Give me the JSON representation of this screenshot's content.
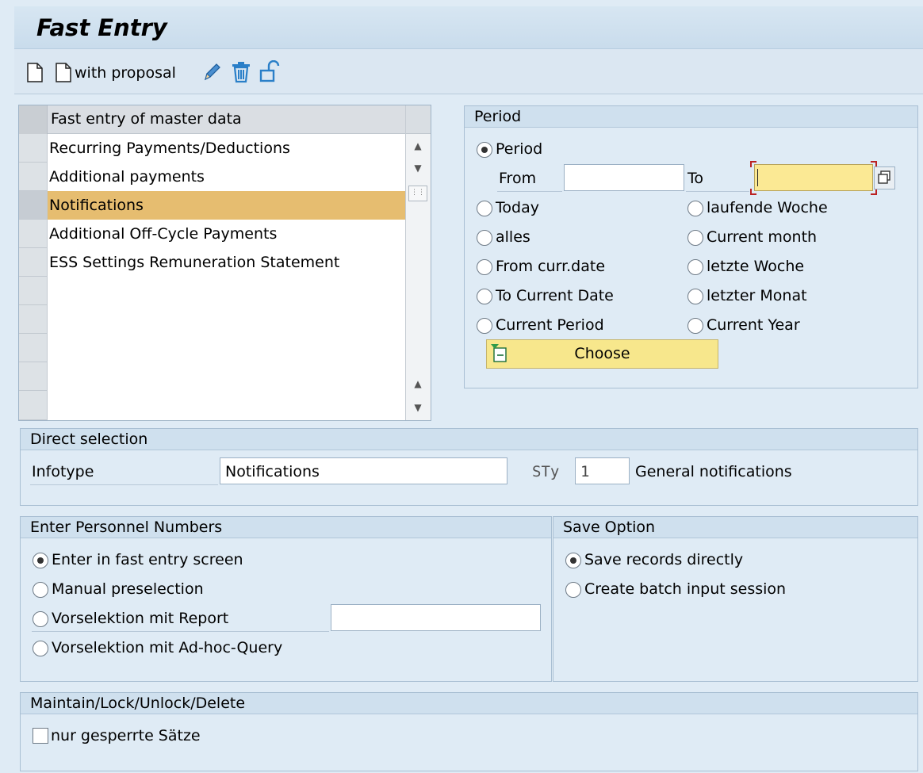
{
  "title": "Fast Entry",
  "toolbar": {
    "with_proposal": "with proposal"
  },
  "list": {
    "header": "Fast entry of master data",
    "rows": [
      "Recurring Payments/Deductions",
      "Additional payments",
      "Notifications",
      "Additional Off-Cycle Payments",
      "ESS Settings Remuneration Statement"
    ],
    "selected": "Notifications"
  },
  "period": {
    "header": "Period",
    "period_label": "Period",
    "from_label": "From",
    "to_label": "To",
    "from_value": "",
    "to_value": "",
    "options_left": [
      "Today",
      "alles",
      "From curr.date",
      "To Current Date",
      "Current Period"
    ],
    "options_right": [
      "laufende Woche",
      "Current month",
      "letzte Woche",
      "letzter Monat",
      "Current Year"
    ],
    "choose_label": "Choose"
  },
  "direct": {
    "header": "Direct selection",
    "infotype_label": "Infotype",
    "infotype_value": "Notifications",
    "sty_label": "STy",
    "sty_value": "1",
    "sty_text": "General notifications"
  },
  "personnel": {
    "header": "Enter Personnel Numbers",
    "options": [
      "Enter in fast entry screen",
      "Manual preselection",
      "Vorselektion mit Report",
      "Vorselektion mit Ad-hoc-Query"
    ],
    "report_value": ""
  },
  "save": {
    "header": "Save Option",
    "options": [
      "Save records directly",
      "Create batch input session"
    ]
  },
  "maintain": {
    "header": "Maintain/Lock/Unlock/Delete",
    "checkbox_label": "nur gesperrte Sätze"
  },
  "colors": {
    "selected_row": "#e6bd70",
    "choose_button": "#f7e78c",
    "required_field": "#fbe994"
  }
}
